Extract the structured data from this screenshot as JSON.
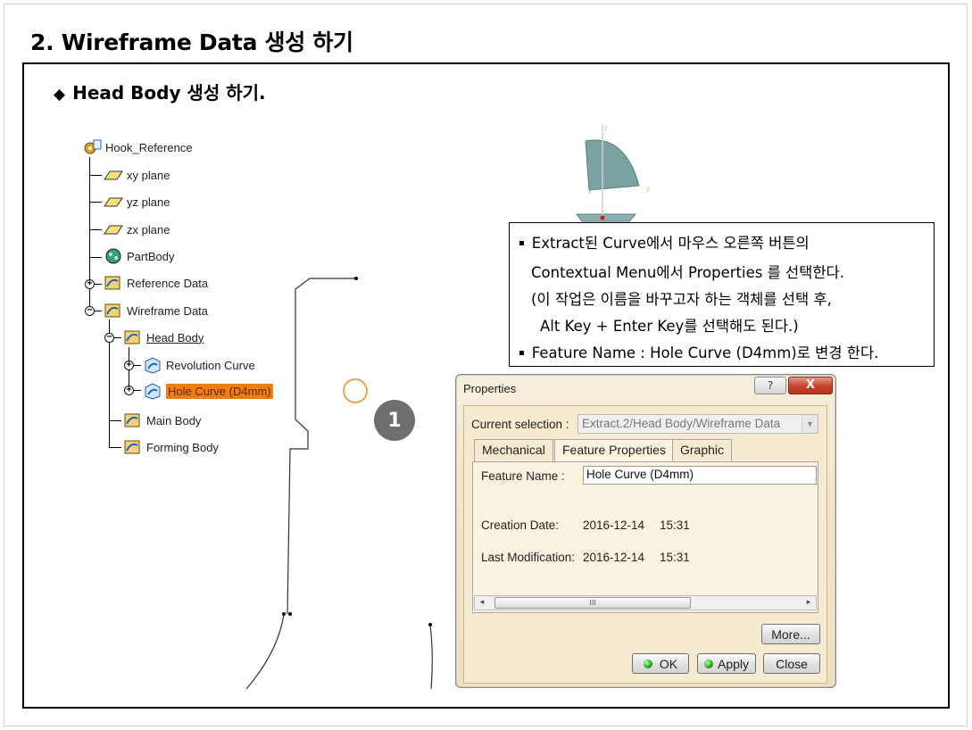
{
  "slide": {
    "title": "2. Wireframe Data 생성 하기",
    "subtitle_marker": "◆",
    "subtitle": "Head Body 생성 하기."
  },
  "tree": {
    "root": "Hook_Reference",
    "items": [
      {
        "label": "xy plane",
        "icon": "plane-icon"
      },
      {
        "label": "yz plane",
        "icon": "plane-icon"
      },
      {
        "label": "zx plane",
        "icon": "plane-icon"
      },
      {
        "label": "PartBody",
        "icon": "partbody-icon"
      },
      {
        "label": "Reference Data",
        "icon": "geometrical-set-icon"
      },
      {
        "label": "Wireframe Data",
        "icon": "geometrical-set-icon"
      },
      {
        "label": "Head Body",
        "icon": "geometrical-set-icon"
      },
      {
        "label": "Revolution Curve",
        "icon": "extract-curve-icon"
      },
      {
        "label": "Hole Curve (D4mm)",
        "icon": "extract-curve-icon"
      },
      {
        "label": "Main Body",
        "icon": "geometrical-set-icon"
      },
      {
        "label": "Forming Body",
        "icon": "geometrical-set-icon"
      }
    ],
    "selected_color": "#f57c0e"
  },
  "step_badge": "1",
  "callout": {
    "bullet": "▪",
    "line1": "Extract된 Curve에서 마우스 오른쪽 버튼의",
    "line2": "Contextual Menu에서 Properties 를 선택한다.",
    "line3": "(이 작업은 이름을 바꾸고자 하는 객체를 선택 후,",
    "line4": "Alt Key + Enter Key를 선택해도 된다.)",
    "line5": "Feature Name : Hole Curve (D4mm)로 변경 한다."
  },
  "dialog": {
    "title": "Properties",
    "help_label": "?",
    "close_label": "X",
    "current_selection_label": "Current selection :",
    "current_selection_value": "Extract.2/Head Body/Wireframe Data",
    "tabs": [
      "Mechanical",
      "Feature Properties",
      "Graphic"
    ],
    "active_tab": "Feature Properties",
    "feature_name_label": "Feature Name :",
    "feature_name_value": "Hole Curve (D4mm)",
    "creation_date_label": "Creation Date:",
    "creation_date": "2016-12-14",
    "creation_time": "15:31",
    "last_mod_label": "Last Modification:",
    "last_mod_date": "2016-12-14",
    "last_mod_time": "15:31",
    "scroll_left": "◂",
    "scroll_thumb": "III",
    "scroll_right": "▸",
    "more_label": "More...",
    "ok_label": "OK",
    "apply_label": "Apply",
    "close_button_label": "Close"
  },
  "axis_labels": {
    "z": "z",
    "x": "x",
    "y": "y"
  },
  "colors": {
    "dialog_bg": "#f3e6c9",
    "close_red": "#c5432c",
    "circle_orange": "#f08a1c",
    "surface_teal": "#7ba3a3",
    "badge_gray": "#6e6e6e"
  }
}
